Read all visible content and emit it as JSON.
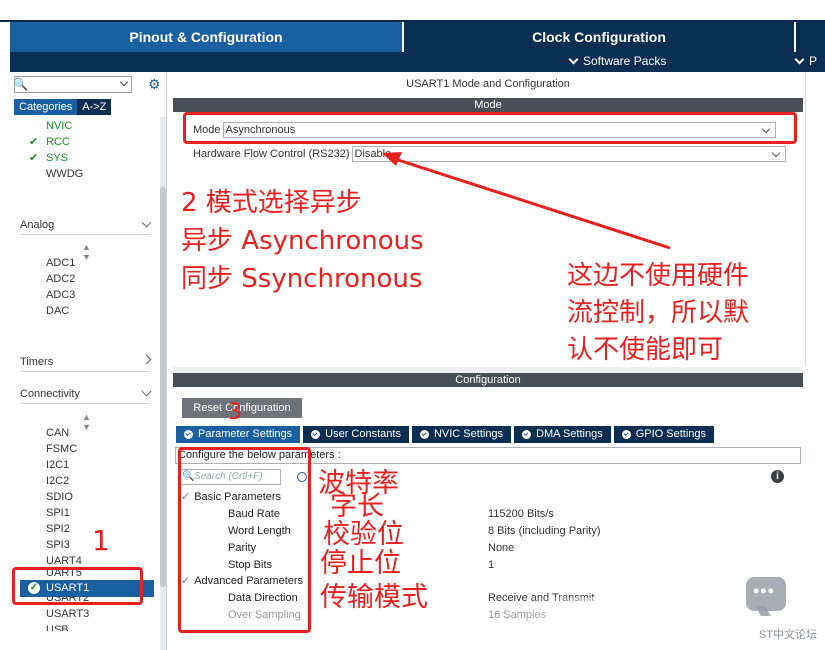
{
  "tabs": {
    "pinout": "Pinout & Configuration",
    "clock": "Clock Configuration",
    "software_packs": "Software Packs",
    "more_cut": "P"
  },
  "sidebar": {
    "categories_tab": "Categories",
    "az_tab": "A->Z",
    "system_items": [
      "NVIC",
      "RCC",
      "SYS",
      "WWDG"
    ],
    "system_checked": [
      false,
      true,
      true,
      false
    ],
    "analog_label": "Analog",
    "analog_items": [
      "ADC1",
      "ADC2",
      "ADC3",
      "DAC"
    ],
    "timers_label": "Timers",
    "connectivity_label": "Connectivity",
    "conn_items": [
      "CAN",
      "FSMC",
      "I2C1",
      "I2C2",
      "SDIO",
      "SPI1",
      "SPI2",
      "SPI3",
      "UART4",
      "UART5"
    ],
    "selected_item": "USART1",
    "after_items": [
      "USART2",
      "USART3",
      "USB"
    ]
  },
  "mode_panel": {
    "title": "USART1 Mode and Configuration",
    "mode_header": "Mode",
    "mode_label": "Mode",
    "mode_value": "Asynchronous",
    "flow_label": "Hardware Flow Control (RS232)",
    "flow_value": "Disable"
  },
  "config_panel": {
    "header": "Configuration",
    "reset_button": "Reset Configuration",
    "tabs": [
      "Parameter Settings",
      "User Constants",
      "NVIC Settings",
      "DMA Settings",
      "GPIO Settings"
    ],
    "configure_line": "Configure the below parameters :",
    "search_placeholder": "Search (Crtl+F)",
    "info_icon": "i"
  },
  "params": {
    "basic_group": "Basic Parameters",
    "baud_label": "Baud Rate",
    "baud_value": "115200 Bits/s",
    "word_label": "Word Length",
    "word_value": "8 Bits (including Parity)",
    "parity_label": "Parity",
    "parity_value": "None",
    "stop_label": "Stop Bits",
    "stop_value": "1",
    "adv_group": "Advanced Parameters",
    "dir_label": "Data Direction",
    "dir_value": "Receive and Transmit",
    "oversampling_label": "Over Sampling",
    "oversampling_value": "16 Samples"
  },
  "annotations": {
    "num1": "1",
    "num3": "3",
    "mode_note_1": "2 模式选择异步",
    "mode_note_2": "异步 Asynchronous",
    "mode_note_3": "同步 Ssynchronous",
    "flow_note_1": "这边不使用硬件",
    "flow_note_2": "流控制，所以默",
    "flow_note_3": "认不使能即可",
    "p_baud": "波特率",
    "p_word": "字长",
    "p_parity": "校验位",
    "p_stop": "停止位",
    "p_dir": "传输模式"
  },
  "watermark": "ST中文论坛",
  "colors": {
    "accent": "#1a5fa0",
    "dark_navy": "#0b2e53",
    "annotation_red": "#e8201f"
  }
}
